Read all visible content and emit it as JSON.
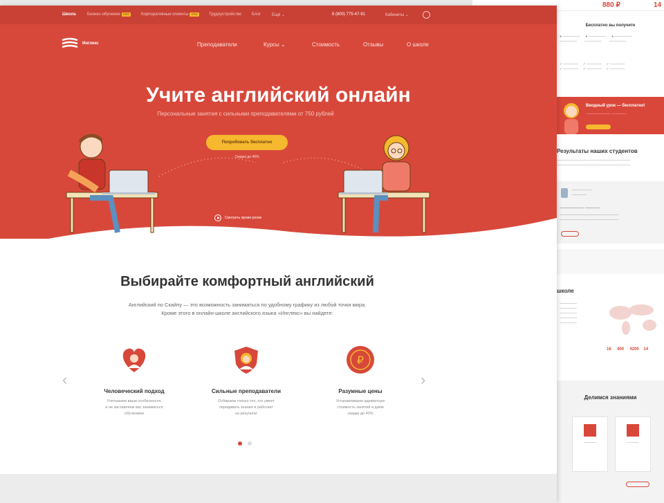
{
  "colors": {
    "brand_red": "#d7483b",
    "dark_red": "#c94034",
    "accent_yellow": "#f5b82e"
  },
  "topbar": {
    "items": [
      "Школа",
      "Бизнес-обучение",
      "Корпоративные клиенты",
      "Трудоустройство",
      "Блог",
      "Ещё"
    ],
    "new_badge": "new",
    "phone": "8 (800) 775-47-91",
    "account": "Кабинеты"
  },
  "logo": {
    "text": "Инглекс",
    "icon": "logo-icon"
  },
  "nav": {
    "items": [
      "Преподаватели",
      "Курсы",
      "Стоимость",
      "Отзывы",
      "О школе"
    ]
  },
  "hero": {
    "title": "Учите английский онлайн",
    "subtitle": "Персональные занятия с сильными преподавателями от 750 рублей",
    "cta": "Попробовать бесплатно",
    "cta_note": "Скидка до 40%",
    "video": "Смотреть промо-ролик"
  },
  "section": {
    "title": "Выбирайте комфортный английский",
    "desc_line1": "Английский по Скайпу — это возможность заниматься по удобному графику из любой точки мира.",
    "desc_line2": "Кроме этого в онлайн-школе английского языка «Инглекс» вы найдете:",
    "features": [
      {
        "title": "Человеческий подход",
        "desc1": "Учитываем ваши особенности,",
        "desc2": "и не заставляем вас заниматься",
        "desc3": "обучением",
        "icon": "heart-person-icon"
      },
      {
        "title": "Сильные преподаватели",
        "desc1": "Отбираем только тех, кто умеет",
        "desc2": "передавать знания и работает",
        "desc3": "на результат",
        "icon": "shield-teacher-icon"
      },
      {
        "title": "Разумные цены",
        "desc1": "Устанавливаем адекватную",
        "desc2": "стоимость занятий и даём",
        "desc3": "скидки до 40%",
        "icon": "ruble-icon"
      }
    ]
  },
  "right_page": {
    "price": "880 ₽",
    "price2": "14",
    "free_title": "Бесплатно вы получите",
    "lesson_title": "Вводный урок — бесплатно!",
    "results_title": "Результаты наших студентов",
    "school_title": "школе",
    "share_title": "Делимся знаниями",
    "stat1": "16",
    "stat2": "400",
    "stat3": "4200",
    "stat4": "14"
  }
}
